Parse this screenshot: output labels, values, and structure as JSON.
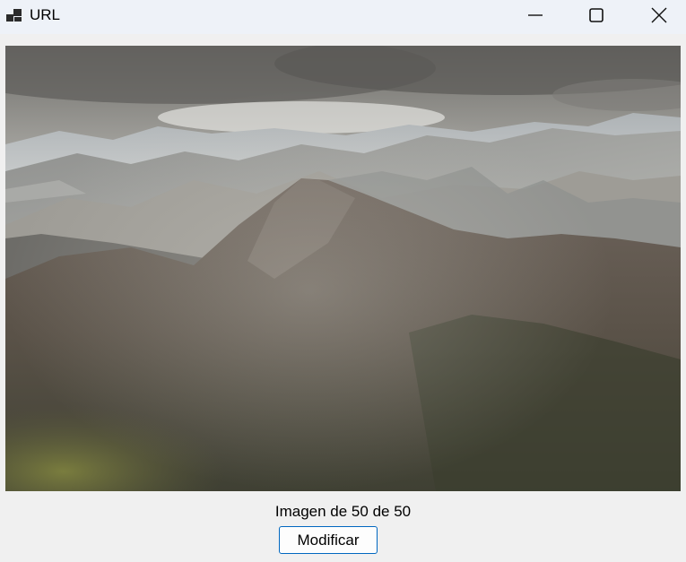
{
  "window": {
    "title": "URL",
    "icon": "app-window-icon",
    "controls": [
      "minimize-icon",
      "maximize-icon",
      "close-icon"
    ]
  },
  "viewer": {
    "image": "mountain-landscape-photo"
  },
  "footer": {
    "counter_text": "Imagen de 50 de 50",
    "modify_label": "Modificar"
  },
  "colors": {
    "titlebar_bg": "#eef2f8",
    "window_bg": "#f0f0f0",
    "button_border": "#0067c0"
  }
}
